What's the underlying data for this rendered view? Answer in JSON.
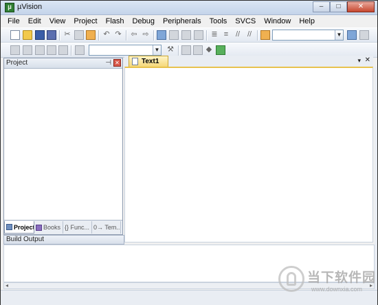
{
  "window": {
    "title": "µVision",
    "icon": "uvision-app-icon",
    "controls": {
      "minimize": "–",
      "maximize": "□",
      "close": "✕"
    }
  },
  "menu": [
    "File",
    "Edit",
    "View",
    "Project",
    "Flash",
    "Debug",
    "Peripherals",
    "Tools",
    "SVCS",
    "Window",
    "Help"
  ],
  "toolbar1": {
    "icons": [
      "new-file-icon",
      "open-file-icon",
      "save-icon",
      "save-all-icon",
      "cut-icon",
      "copy-icon",
      "paste-icon",
      "undo-icon",
      "redo-icon",
      "navigate-back-icon",
      "navigate-forward-icon",
      "bookmark-icon",
      "prev-bookmark-icon",
      "next-bookmark-icon",
      "clear-bookmarks-icon",
      "indent-icon",
      "unindent-icon",
      "comment-icon",
      "uncomment-icon",
      "find-in-files-icon",
      "find-icon",
      "config-icon"
    ],
    "find_combo_value": ""
  },
  "toolbar2": {
    "icons": [
      "translate-icon",
      "build-icon",
      "rebuild-icon",
      "batch-build-icon",
      "download-icon",
      "load-icon",
      "target-options-icon",
      "file-extensions-icon",
      "manage-components-icon",
      "pack-installer-icon",
      "select-device-icon"
    ],
    "target_combo_value": ""
  },
  "project_pane": {
    "title": "Project",
    "pin_glyph": "⊣",
    "close_glyph": "✕",
    "tabs": [
      {
        "label": "Project",
        "active": true
      },
      {
        "label": "Books",
        "active": false
      },
      {
        "label": "{} Func...",
        "active": false
      },
      {
        "label": "0→ Tem...",
        "active": false
      }
    ]
  },
  "editor": {
    "tab_label": "Text1",
    "tab_arrow": "▾",
    "tab_close": "✕"
  },
  "build_output": {
    "title": "Build Output"
  },
  "colors": {
    "editor_tab": "#f5d879",
    "titlebar": "#c4d4ea",
    "close_button": "#c7472f"
  }
}
